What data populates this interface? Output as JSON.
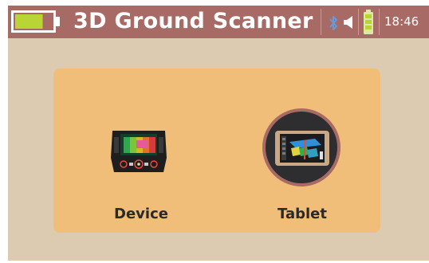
{
  "header": {
    "title": "3D Ground Scanner",
    "time": "18:46",
    "battery_level": 0.75,
    "status_icons": [
      "battery-icon",
      "bluetooth-icon",
      "speaker-icon",
      "signal-battery-icon"
    ]
  },
  "menu": {
    "options": [
      {
        "label": "Device",
        "icon": "device-icon"
      },
      {
        "label": "Tablet",
        "icon": "tablet-icon"
      }
    ]
  },
  "colors": {
    "header": "#a76a64",
    "background": "#dccbb0",
    "panel": "#f0be78",
    "accent_green": "#b8d435",
    "text": "#2a2a2a"
  }
}
